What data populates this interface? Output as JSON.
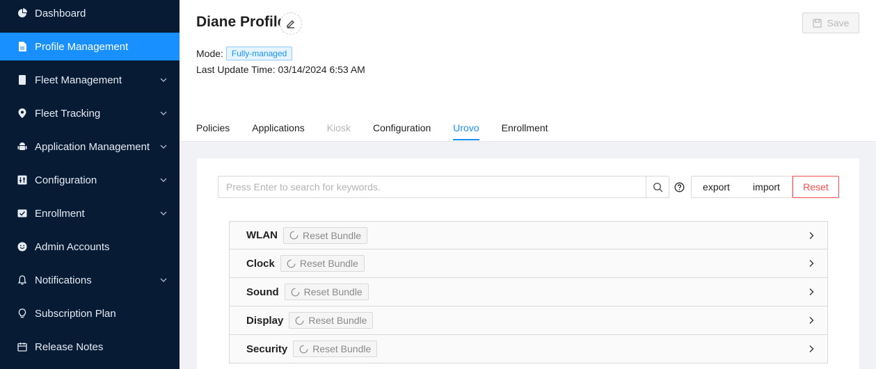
{
  "sidebar": {
    "items": [
      {
        "label": "Dashboard",
        "icon": "dashboard-icon",
        "expandable": false
      },
      {
        "label": "Profile Management",
        "icon": "file-icon",
        "expandable": false
      },
      {
        "label": "Fleet Management",
        "icon": "tablet-icon",
        "expandable": true
      },
      {
        "label": "Fleet Tracking",
        "icon": "location-icon",
        "expandable": true
      },
      {
        "label": "Application Management",
        "icon": "android-icon",
        "expandable": true
      },
      {
        "label": "Configuration",
        "icon": "sliders-icon",
        "expandable": true
      },
      {
        "label": "Enrollment",
        "icon": "enrollment-icon",
        "expandable": true
      },
      {
        "label": "Admin Accounts",
        "icon": "smiley-icon",
        "expandable": false
      },
      {
        "label": "Notifications",
        "icon": "bell-icon",
        "expandable": true
      },
      {
        "label": "Subscription Plan",
        "icon": "bulb-icon",
        "expandable": false
      },
      {
        "label": "Release Notes",
        "icon": "calendar-icon",
        "expandable": false
      }
    ],
    "active_index": 1
  },
  "header": {
    "title": "Diane Profile",
    "save_label": "Save",
    "mode_label": "Mode:",
    "mode_value": "Fully-managed",
    "update_label": "Last Update Time:",
    "update_value": "03/14/2024 6:53 AM",
    "tabs": [
      {
        "label": "Policies",
        "state": "normal"
      },
      {
        "label": "Applications",
        "state": "normal"
      },
      {
        "label": "Kiosk",
        "state": "disabled"
      },
      {
        "label": "Configuration",
        "state": "normal"
      },
      {
        "label": "Urovo",
        "state": "active"
      },
      {
        "label": "Enrollment",
        "state": "normal"
      }
    ]
  },
  "toolbar": {
    "search_placeholder": "Press Enter to search for keywords.",
    "export_label": "export",
    "import_label": "import",
    "reset_label": "Reset"
  },
  "bundles": {
    "reset_label": "Reset Bundle",
    "items": [
      "WLAN",
      "Clock",
      "Sound",
      "Display",
      "Security"
    ]
  },
  "colors": {
    "sidebar_bg": "#071b35",
    "accent": "#1890ff",
    "danger": "#ff4d4f"
  }
}
